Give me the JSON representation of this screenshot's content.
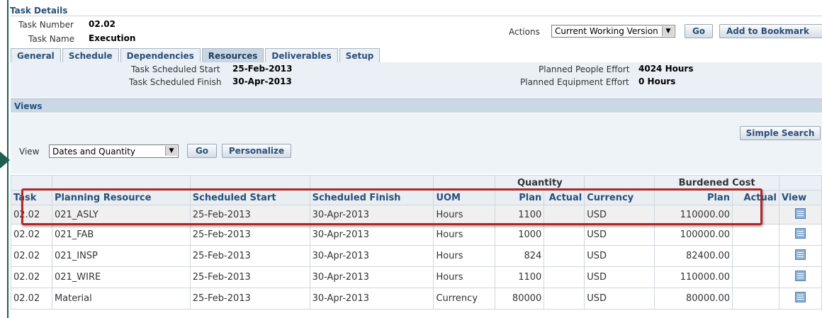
{
  "header": {
    "title": "Task Details",
    "task_number_label": "Task Number",
    "task_number": "02.02",
    "task_name_label": "Task Name",
    "task_name": "Execution",
    "actions_label": "Actions",
    "actions_value": "Current Working Version",
    "go_label": "Go",
    "bookmark_label": "Add to Bookmark"
  },
  "tabs": [
    "General",
    "Schedule",
    "Dependencies",
    "Resources",
    "Deliverables",
    "Setup"
  ],
  "active_tab": "Resources",
  "info": {
    "start_label": "Task Scheduled Start",
    "start_value": "25-Feb-2013",
    "finish_label": "Task Scheduled Finish",
    "finish_value": "30-Apr-2013",
    "people_label": "Planned People Effort",
    "people_value": "4024 Hours",
    "equipment_label": "Planned Equipment Effort",
    "equipment_value": "0 Hours"
  },
  "views": {
    "title": "Views",
    "simple_search": "Simple Search",
    "view_label": "View",
    "view_value": "Dates and Quantity",
    "go_label": "Go",
    "personalize_label": "Personalize"
  },
  "table": {
    "groups": {
      "quantity": "Quantity",
      "burdened_cost": "Burdened Cost"
    },
    "columns": [
      "Task",
      "Planning Resource",
      "Scheduled Start",
      "Scheduled Finish",
      "UOM",
      "Plan",
      "Actual",
      "Currency",
      "Plan",
      "Actual",
      "View"
    ],
    "rows": [
      [
        "02.02",
        "021_ASLY",
        "25-Feb-2013",
        "30-Apr-2013",
        "Hours",
        "1100",
        "",
        "USD",
        "110000.00",
        ""
      ],
      [
        "02.02",
        "021_FAB",
        "25-Feb-2013",
        "30-Apr-2013",
        "Hours",
        "1000",
        "",
        "USD",
        "100000.00",
        ""
      ],
      [
        "02.02",
        "021_INSP",
        "25-Feb-2013",
        "30-Apr-2013",
        "Hours",
        "824",
        "",
        "USD",
        "82400.00",
        ""
      ],
      [
        "02.02",
        "021_WIRE",
        "25-Feb-2013",
        "30-Apr-2013",
        "Hours",
        "1100",
        "",
        "USD",
        "110000.00",
        ""
      ],
      [
        "02.02",
        "Material",
        "25-Feb-2013",
        "30-Apr-2013",
        "Currency",
        "80000",
        "",
        "USD",
        "80000.00",
        ""
      ]
    ]
  },
  "colors": {
    "accent": "#294f7a",
    "highlight": "#b42626",
    "border_left": "#1f5f4f"
  },
  "icons": {
    "view_row": "grid-view-icon",
    "dropdown": "dropdown-arrow-icon"
  }
}
